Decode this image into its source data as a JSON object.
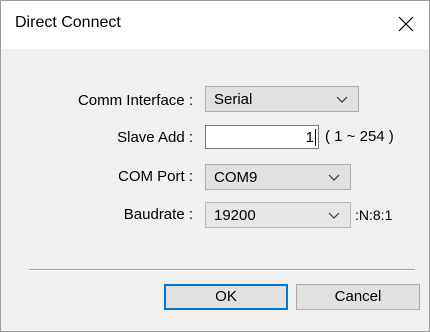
{
  "window": {
    "title": "Direct Connect"
  },
  "form": {
    "comm_interface": {
      "label": "Comm Interface :",
      "value": "Serial"
    },
    "slave_add": {
      "label": "Slave Add :",
      "value": "1",
      "range": "( 1 ~ 254 )"
    },
    "com_port": {
      "label": "COM Port :",
      "value": "COM9"
    },
    "baudrate": {
      "label": "Baudrate :",
      "value": "19200",
      "suffix": ":N:8:1"
    }
  },
  "buttons": {
    "ok": "OK",
    "cancel": "Cancel"
  },
  "icons": {
    "close": "close-icon",
    "dropdown": "chevron-down-icon"
  },
  "colors": {
    "default_button_border": "#0078d7",
    "dialog_bg": "#f0f0f0"
  }
}
